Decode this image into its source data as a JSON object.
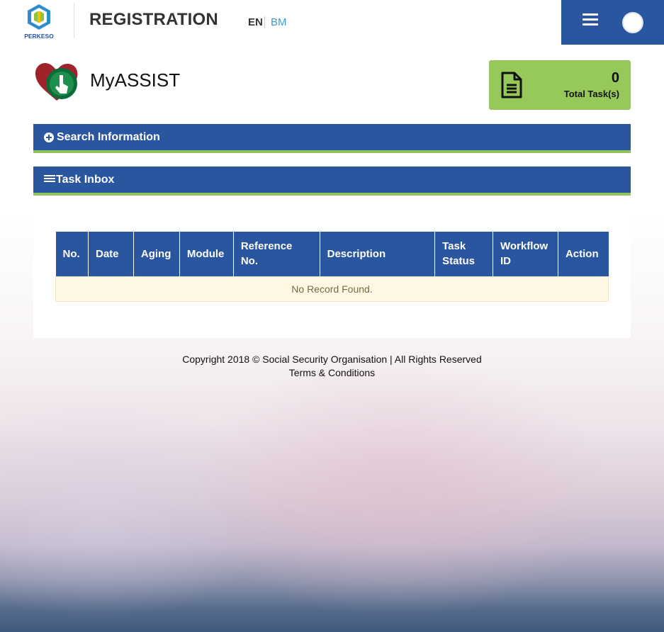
{
  "header": {
    "logo_text": "PERKESO",
    "title": "REGISTRATION",
    "lang_en": "EN",
    "lang_bm": "BM",
    "menu_icon": "hamburger-icon",
    "avatar_icon": "user-avatar-icon"
  },
  "brand": {
    "name": "MyASSIST",
    "icon": "myassist-logo-icon"
  },
  "task_card": {
    "count": "0",
    "label": "Total Task(s)",
    "icon": "document-icon",
    "color": "#97c85a"
  },
  "search_panel": {
    "title": "Search Information",
    "icon": "plus-circle-icon"
  },
  "inbox_panel": {
    "title": "Task Inbox",
    "icon": "list-icon"
  },
  "table": {
    "columns": [
      "No.",
      "Date",
      "Aging",
      "Module",
      "Reference No.",
      "Description",
      "Task Status",
      "Workflow ID",
      "Action"
    ],
    "empty_message": "No Record Found."
  },
  "footer": {
    "copyright": "Copyright 2018 © Social Security Organisation | All Rights Reserved",
    "terms": "Terms & Conditions"
  },
  "colors": {
    "primary": "#2a56a0",
    "accent_green": "#8fc45a",
    "link_blue": "#3b9ad0"
  }
}
